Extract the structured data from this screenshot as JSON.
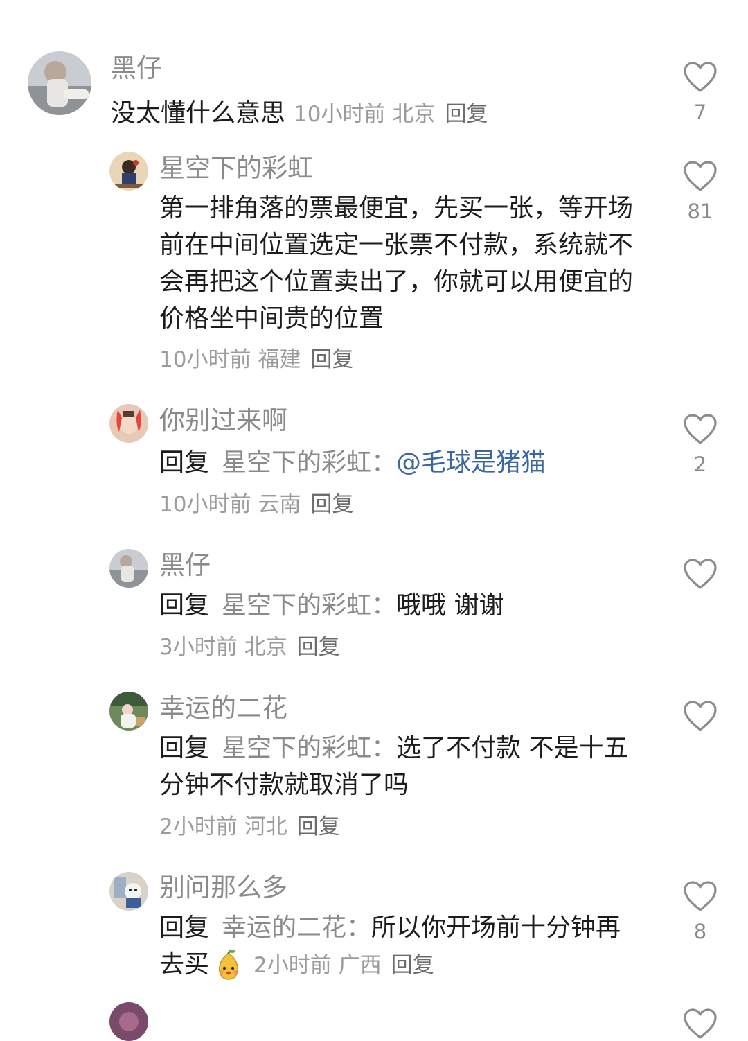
{
  "comments": [
    {
      "user": "黑仔",
      "text": "没太懂什么意思",
      "time": "10小时前",
      "location": "北京",
      "reply_label": "回复",
      "likes": "7"
    },
    {
      "user": "星空下的彩虹",
      "text": "第一排角落的票最便宜，先买一张，等开场前在中间位置选定一张票不付款，系统就不会再把这个位置卖出了，你就可以用便宜的价格坐中间贵的位置",
      "time": "10小时前",
      "location": "福建",
      "reply_label": "回复",
      "likes": "81"
    },
    {
      "user": "你别过来啊",
      "reply_prefix": "回复",
      "reply_target": "星空下的彩虹：",
      "text": "@毛球是猪猫",
      "time": "10小时前",
      "location": "云南",
      "reply_label": "回复",
      "likes": "2"
    },
    {
      "user": "黑仔",
      "reply_prefix": "回复",
      "reply_target": "星空下的彩虹：",
      "text": "哦哦 谢谢",
      "time": "3小时前",
      "location": "北京",
      "reply_label": "回复",
      "likes": ""
    },
    {
      "user": "幸运的二花",
      "reply_prefix": "回复",
      "reply_target": "星空下的彩虹：",
      "text": "选了不付款 不是十五分钟不付款就取消了吗",
      "time": "2小时前",
      "location": "河北",
      "reply_label": "回复",
      "likes": ""
    },
    {
      "user": "别问那么多",
      "reply_prefix": "回复",
      "reply_target": "幸运的二花：",
      "text": "所以你开场前十分钟再去买",
      "emoji": "pear-face-emoji",
      "time": "2小时前",
      "location": "广西",
      "reply_label": "回复",
      "likes": "8"
    }
  ],
  "icons": {
    "like": "heart-outline-icon"
  },
  "colors": {
    "mention": "#3a66a6",
    "username": "#8a8a8a",
    "meta": "#9b9b9b"
  }
}
